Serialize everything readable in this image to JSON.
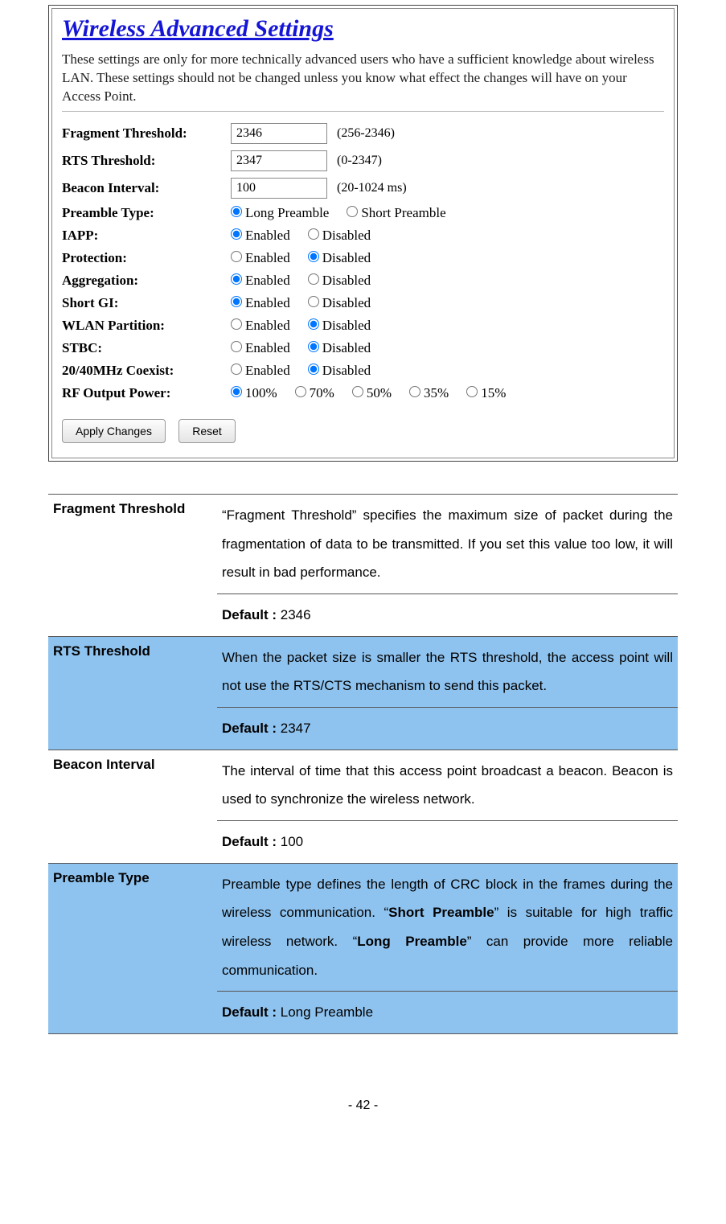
{
  "panel": {
    "title": "Wireless Advanced Settings",
    "desc": "These settings are only for more technically advanced users who have a sufficient knowledge about wireless LAN. These settings should not be changed unless you know what effect the changes will have on your Access Point.",
    "rows": {
      "frag": {
        "label": "Fragment Threshold:",
        "value": "2346",
        "range": "(256-2346)"
      },
      "rts": {
        "label": "RTS Threshold:",
        "value": "2347",
        "range": "(0-2347)"
      },
      "beacon": {
        "label": "Beacon Interval:",
        "value": "100",
        "range": "(20-1024 ms)"
      },
      "preamble": {
        "label": "Preamble Type:",
        "opts": [
          "Long Preamble",
          "Short Preamble"
        ],
        "sel": 0
      },
      "iapp": {
        "label": "IAPP:",
        "opts": [
          "Enabled",
          "Disabled"
        ],
        "sel": 0
      },
      "prot": {
        "label": "Protection:",
        "opts": [
          "Enabled",
          "Disabled"
        ],
        "sel": 1
      },
      "agg": {
        "label": "Aggregation:",
        "opts": [
          "Enabled",
          "Disabled"
        ],
        "sel": 0
      },
      "sgi": {
        "label": "Short GI:",
        "opts": [
          "Enabled",
          "Disabled"
        ],
        "sel": 0
      },
      "wlanp": {
        "label": "WLAN Partition:",
        "opts": [
          "Enabled",
          "Disabled"
        ],
        "sel": 1
      },
      "stbc": {
        "label": "STBC:",
        "opts": [
          "Enabled",
          "Disabled"
        ],
        "sel": 1
      },
      "coex": {
        "label": "20/40MHz Coexist:",
        "opts": [
          "Enabled",
          "Disabled"
        ],
        "sel": 1
      },
      "rf": {
        "label": "RF Output Power:",
        "opts": [
          "100%",
          "70%",
          "50%",
          "35%",
          "15%"
        ],
        "sel": 0
      }
    },
    "buttons": {
      "apply": "Apply Changes",
      "reset": "Reset"
    }
  },
  "table": {
    "rows": [
      {
        "name": "Fragment Threshold",
        "desc": "“Fragment Threshold” specifies the maximum size of packet during the fragmentation of data to be transmitted. If you set this value too low, it will result in bad performance.",
        "default_label": "Default : ",
        "default_value": "2346",
        "alt": false
      },
      {
        "name": "RTS Threshold",
        "desc": "When the packet size is smaller the RTS threshold, the access point will not use the RTS/CTS mechanism to send this packet.",
        "default_label": "Default : ",
        "default_value": "2347",
        "alt": true
      },
      {
        "name": "Beacon Interval",
        "desc": "The interval of time that this access point broadcast a beacon. Beacon is used to synchronize the wireless network.",
        "default_label": "Default : ",
        "default_value": "100",
        "alt": false
      },
      {
        "name": "Preamble Type",
        "desc_pre": "Preamble type defines the length of CRC block in the frames during the wireless communication. “",
        "desc_b1": "Short Preamble",
        "desc_mid": "” is suitable for high traffic wireless network. “",
        "desc_b2": "Long Preamble",
        "desc_post": "” can provide more reliable communication.",
        "default_label": "Default : ",
        "default_value": "Long Preamble",
        "alt": true
      }
    ]
  },
  "page_number": "- 42 -"
}
